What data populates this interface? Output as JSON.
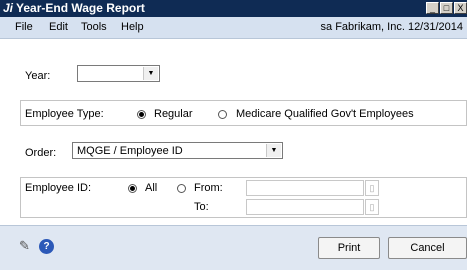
{
  "window": {
    "title": "Year-End Wage Report",
    "title_icon": "Ji",
    "buttons": {
      "minimize": "_",
      "maximize": "□",
      "close": "X"
    }
  },
  "menu": {
    "items": [
      "File",
      "Edit",
      "Tools",
      "Help"
    ],
    "info": "sa  Fabrikam, Inc.  12/31/2014"
  },
  "form": {
    "year_label": "Year:",
    "year_value": "",
    "employee_type": {
      "label": "Employee Type:",
      "options": [
        "Regular",
        "Medicare Qualified Gov't Employees"
      ],
      "selected": "Regular"
    },
    "order": {
      "label": "Order:",
      "value": "MQGE / Employee ID"
    },
    "employee_id": {
      "label": "Employee ID:",
      "all_label": "All",
      "from_label": "From:",
      "to_label": "To:",
      "selected": "All",
      "from_value": "",
      "to_value": ""
    }
  },
  "footer": {
    "print_label": "Print",
    "cancel_label": "Cancel",
    "help_glyph": "?"
  },
  "icons": {
    "note": "note-icon",
    "help": "help-icon",
    "lookup": "lookup-icon"
  }
}
